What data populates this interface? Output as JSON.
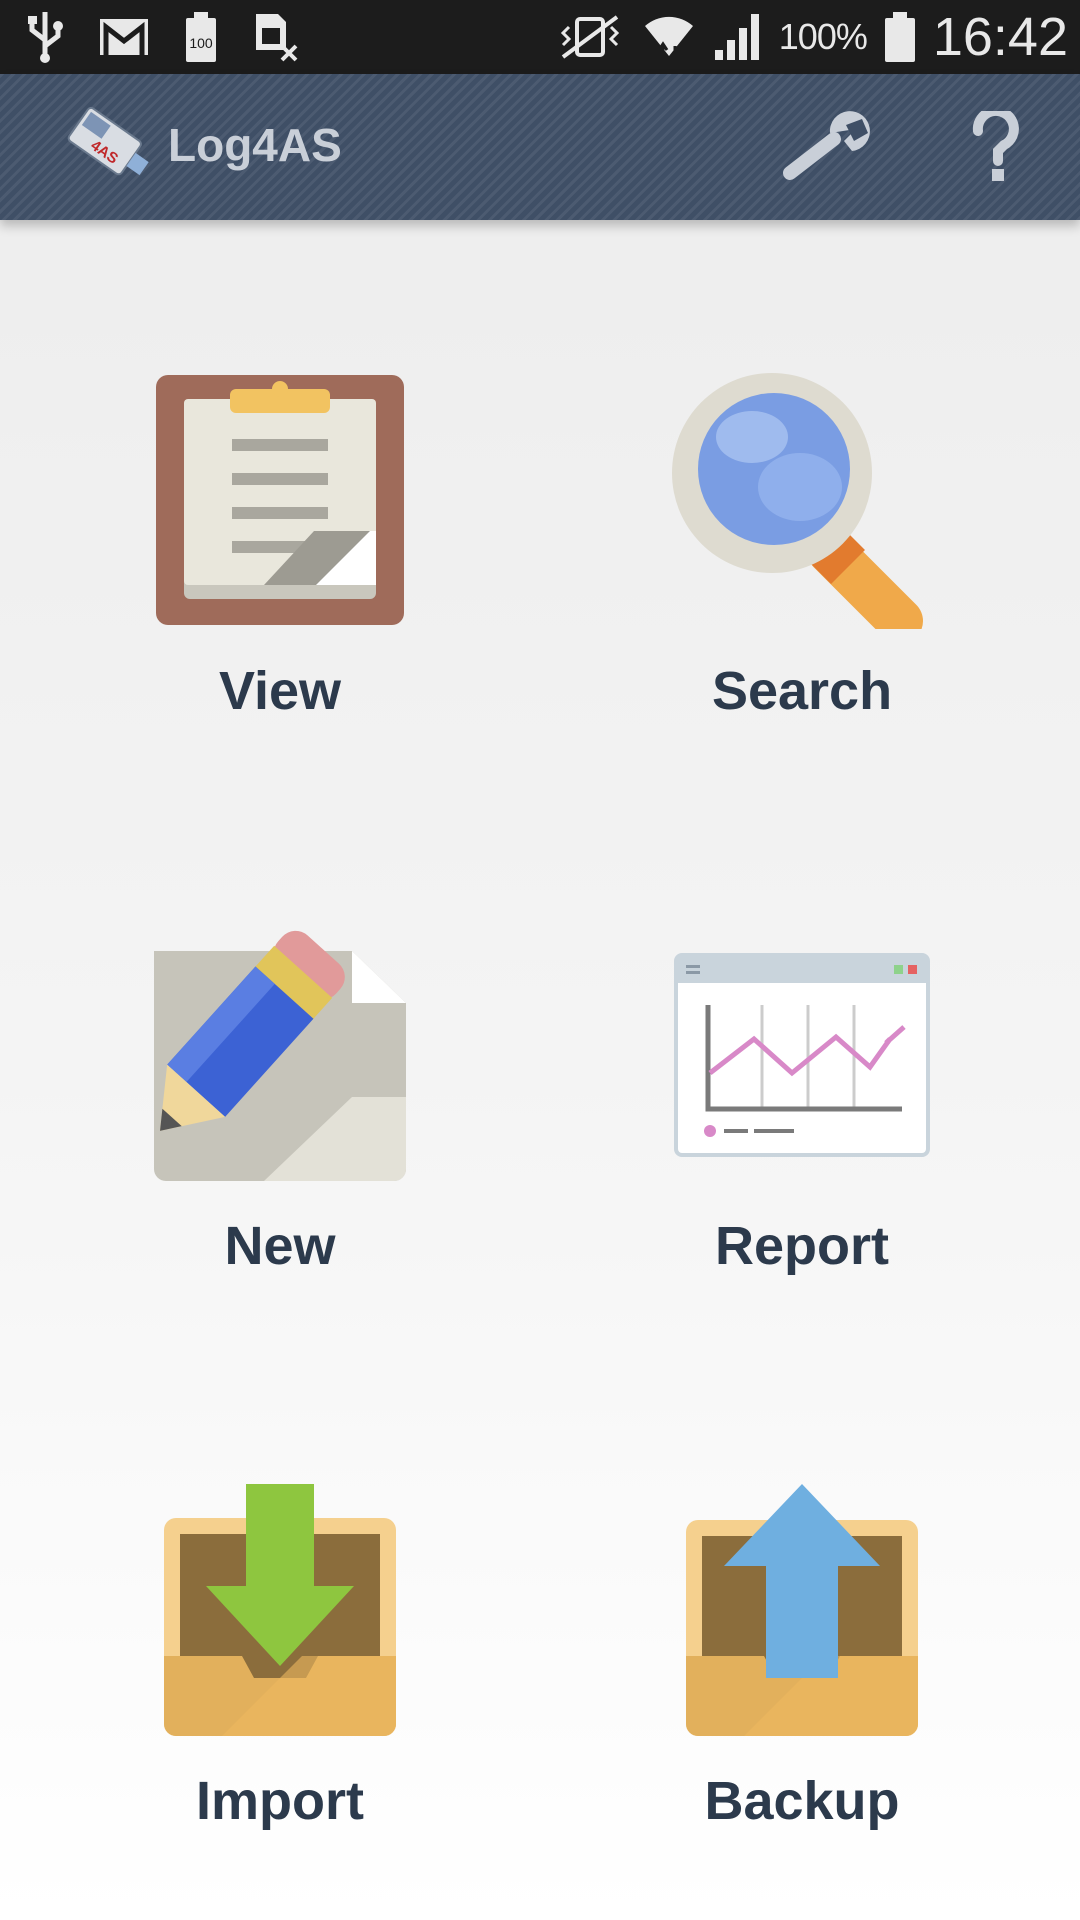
{
  "status_bar": {
    "left_icons": [
      "usb-icon",
      "gmail-icon",
      "battery-100-icon",
      "sim-card-off-icon"
    ],
    "right_icons": [
      "vibrate-icon",
      "wifi-icon",
      "signal-icon",
      "battery-icon"
    ],
    "battery_percent": "100%",
    "time": "16:42"
  },
  "action_bar": {
    "logo_icon": "log4as-logo-icon",
    "logo_text": "4AS",
    "title": "Log4AS",
    "settings_icon": "wrench-icon",
    "help_icon": "question-mark-icon"
  },
  "menu": {
    "items": [
      {
        "label": "View",
        "icon": "clipboard-icon"
      },
      {
        "label": "Search",
        "icon": "magnifier-icon"
      },
      {
        "label": "New",
        "icon": "pencil-icon"
      },
      {
        "label": "Report",
        "icon": "line-chart-icon"
      },
      {
        "label": "Import",
        "icon": "tray-download-icon"
      },
      {
        "label": "Backup",
        "icon": "tray-upload-icon"
      }
    ]
  },
  "colors": {
    "status_bar_bg": "#1c1c1c",
    "action_bar_bg": "#3f4f66",
    "label_text": "#2c3a4c"
  }
}
